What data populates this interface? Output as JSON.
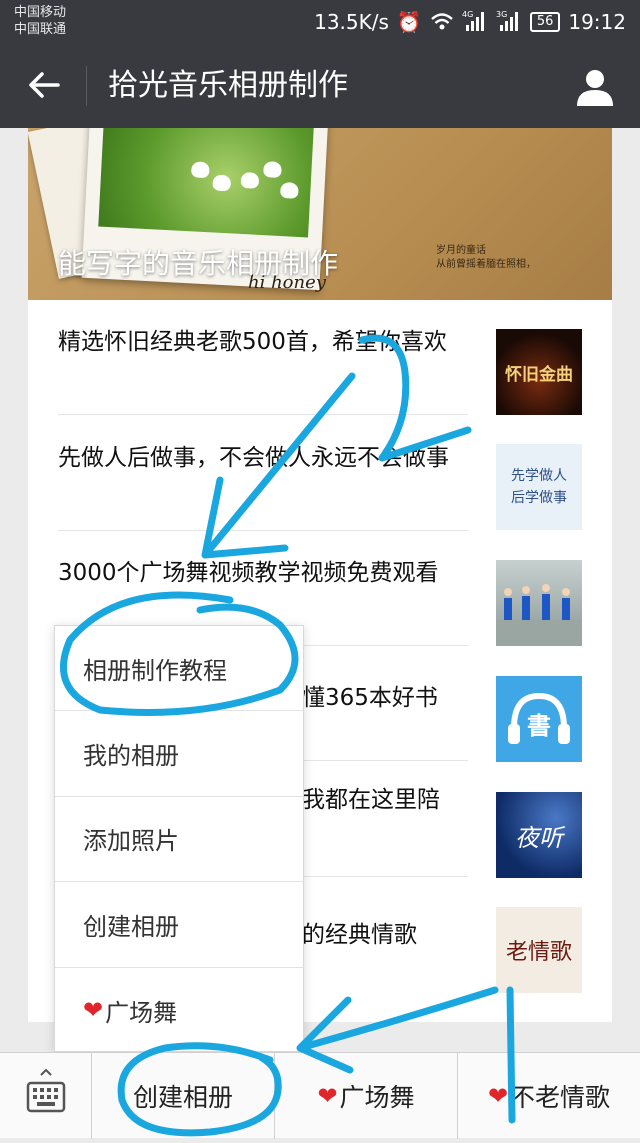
{
  "status": {
    "carrier1": "中国移动",
    "carrier2": "中国联通",
    "speed": "13.5K/s",
    "net1": "4G",
    "net2": "3G",
    "battery": "56",
    "time": "19:12"
  },
  "header": {
    "title": "拾光音乐相册制作"
  },
  "banner": {
    "caption": "能写字的音乐相册制作",
    "quote_line1": "岁月的童话",
    "quote_line2": "从前曾摇着腼在照相，",
    "signature": "hi honey"
  },
  "articles": [
    {
      "title": "精选怀旧经典老歌500首，希望你喜欢",
      "thumb_text": "怀旧金曲"
    },
    {
      "title": "先做人后做事，不会做人永远不会做事",
      "thumb_text": "先学做人 后学做事"
    },
    {
      "title": "3000个广场舞视频教学视频免费观看",
      "thumb_text": ""
    },
    {
      "title": "懂365本好书",
      "thumb_text": "書"
    },
    {
      "title": "我都在这里陪",
      "thumb_text": "夜听"
    },
    {
      "title": "的经典情歌",
      "thumb_text": "老情歌"
    }
  ],
  "menu": {
    "items": [
      "相册制作教程",
      "我的相册",
      "添加照片",
      "创建相册",
      "广场舞"
    ]
  },
  "bottom": {
    "tab1": "创建相册",
    "tab2": "广场舞",
    "tab3": "不老情歌"
  },
  "colors": {
    "bar": "#393a3f",
    "annotation": "#1aa7e0",
    "heart": "#e0262b"
  }
}
